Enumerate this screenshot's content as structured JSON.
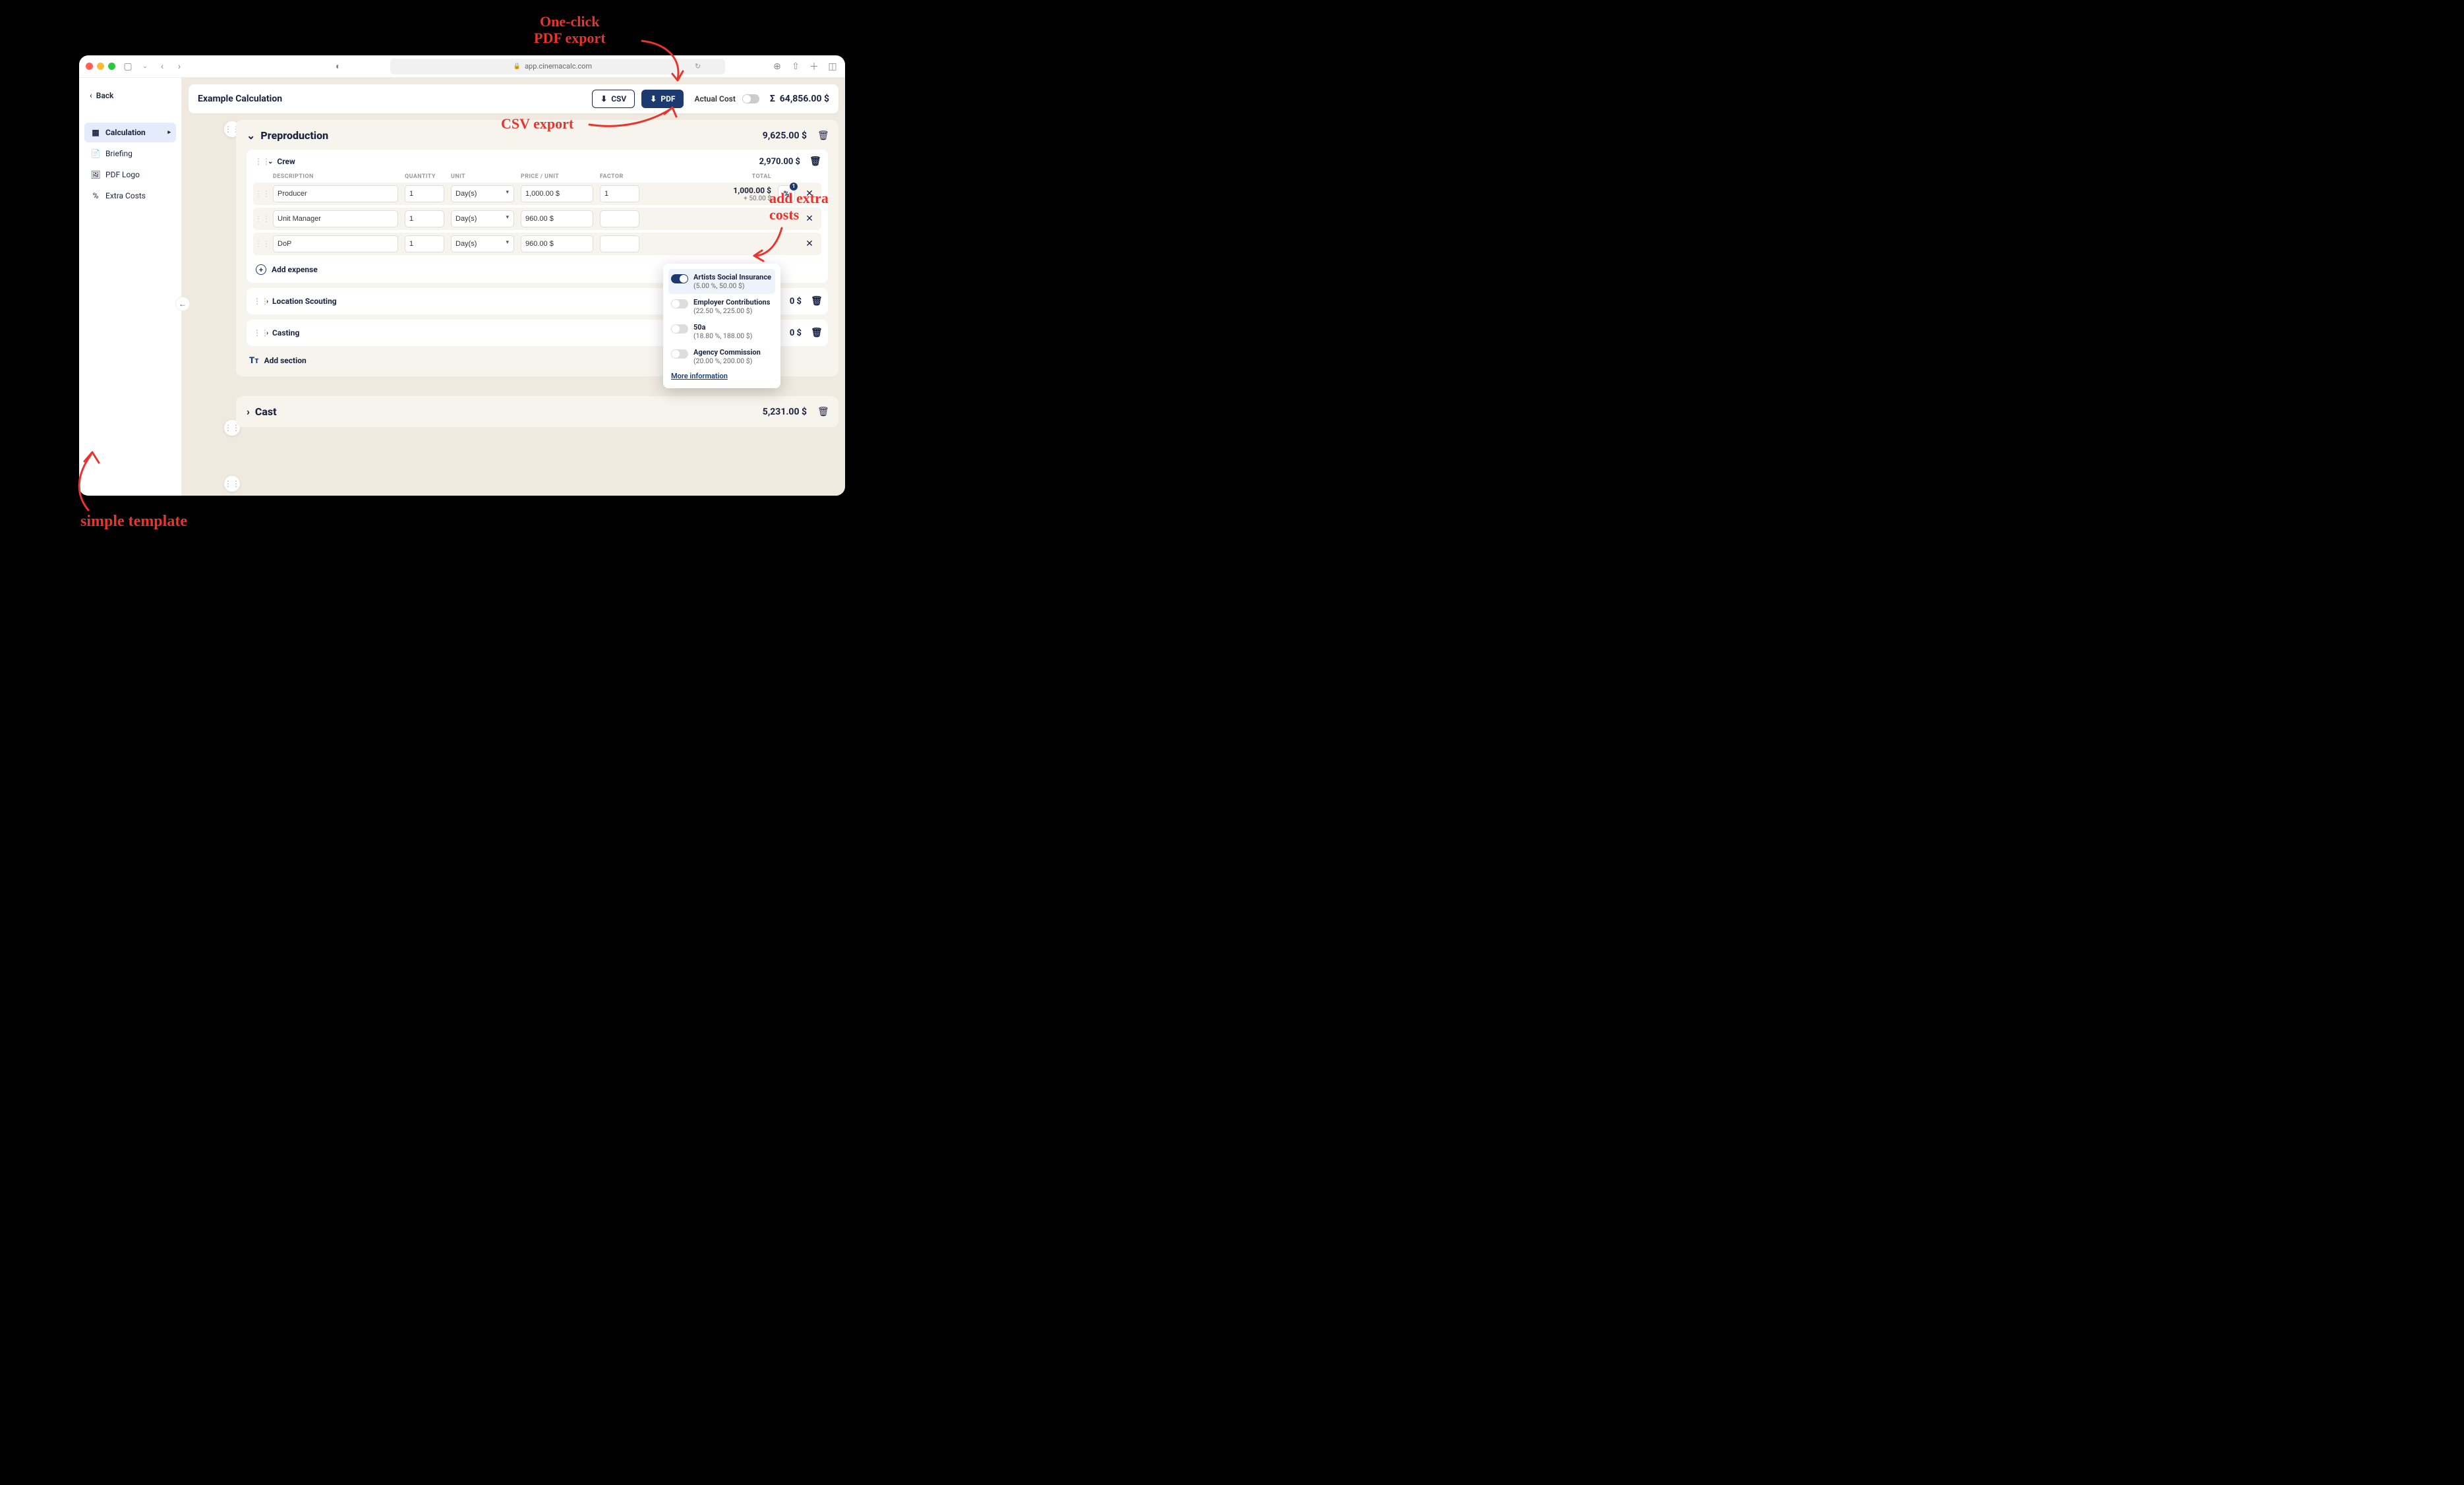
{
  "annotations": {
    "pdf": "One-click\nPDF export",
    "csv": "CSV export",
    "extra": "add extra\ncosts",
    "template": "simple template"
  },
  "browser": {
    "url": "app.cinemacalc.com"
  },
  "sidebar": {
    "back": "Back",
    "items": [
      {
        "label": "Calculation"
      },
      {
        "label": "Briefing"
      },
      {
        "label": "PDF Logo"
      },
      {
        "label": "Extra Costs"
      }
    ]
  },
  "header": {
    "title": "Example Calculation",
    "csv_btn": "CSV",
    "pdf_btn": "PDF",
    "actual_cost_label": "Actual Cost",
    "total": "64,856.00 $"
  },
  "sections": {
    "preprod": {
      "title": "Preproduction",
      "total": "9,625.00 $",
      "crew": {
        "title": "Crew",
        "total": "2,970.00 $",
        "columns": {
          "desc": "DESCRIPTION",
          "qty": "QUANTITY",
          "unit": "UNIT",
          "price": "PRICE / UNIT",
          "factor": "FACTOR",
          "total": "TOTAL"
        },
        "rows": [
          {
            "desc": "Producer",
            "qty": "1",
            "unit": "Day(s)",
            "price": "1,000.00 $",
            "factor": "1",
            "total": "1,000.00 $",
            "extra": "+ 50.00 $",
            "badge": "1"
          },
          {
            "desc": "Unit Manager",
            "qty": "1",
            "unit": "Day(s)",
            "price": "960.00 $",
            "factor": "",
            "total": "",
            "extra": ""
          },
          {
            "desc": "DoP",
            "qty": "1",
            "unit": "Day(s)",
            "price": "960.00 $",
            "factor": "",
            "total": "",
            "extra": ""
          }
        ],
        "add_expense": "Add expense"
      },
      "collapsed": [
        {
          "title": "Location Scouting",
          "total": "0 $"
        },
        {
          "title": "Casting",
          "total": "0 $"
        }
      ],
      "add_section": "Add section"
    },
    "cast": {
      "title": "Cast",
      "total": "5,231.00 $"
    }
  },
  "popover": {
    "items": [
      {
        "name": "Artists Social Insurance",
        "sub": "(5.00 %, 50.00 $)",
        "on": true
      },
      {
        "name": "Employer Contributions",
        "sub": "(22.50 %, 225.00 $)",
        "on": false
      },
      {
        "name": "50a",
        "sub": "(18.80 %, 188.00 $)",
        "on": false
      },
      {
        "name": "Agency Commission",
        "sub": "(20.00 %, 200.00 $)",
        "on": false
      }
    ],
    "link": "More information"
  }
}
